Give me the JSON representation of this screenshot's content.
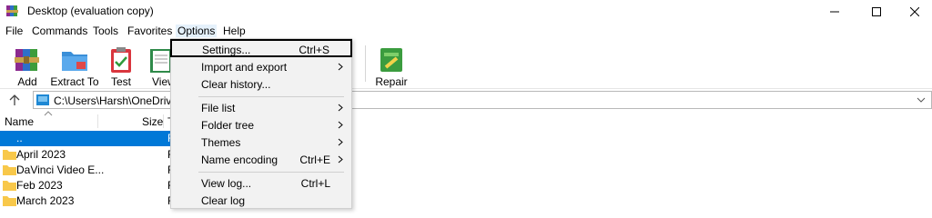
{
  "window": {
    "title": "Desktop (evaluation copy)",
    "icon": "winrar-books-icon",
    "controls": [
      "minimize-icon",
      "maximize-icon",
      "close-icon"
    ]
  },
  "menubar": {
    "items": [
      "File",
      "Commands",
      "Tools",
      "Favorites",
      "Options",
      "Help"
    ],
    "active": "Options"
  },
  "toolbar": {
    "buttons": [
      {
        "label": "Add",
        "icon": "add-archive-icon"
      },
      {
        "label": "Extract To",
        "icon": "extract-folder-icon"
      },
      {
        "label": "Test",
        "icon": "test-clipboard-icon"
      },
      {
        "label": "View",
        "icon": "view-book-icon"
      },
      {
        "label": "Repair",
        "icon": "repair-kit-icon"
      }
    ]
  },
  "addressbar": {
    "path": "C:\\Users\\Harsh\\OneDrive\\D",
    "up_icon": "up-arrow-icon",
    "chevron_icon": "chevron-down-icon"
  },
  "filelist": {
    "headers": {
      "name": "Name",
      "size": "Size",
      "type": "T"
    },
    "rows": [
      {
        "name": "..",
        "type": "F",
        "selected": true
      },
      {
        "name": "April 2023",
        "type": "F",
        "selected": false
      },
      {
        "name": "DaVinci Video E...",
        "type": "F",
        "selected": false
      },
      {
        "name": "Feb 2023",
        "type": "F",
        "selected": false
      },
      {
        "name": "March 2023",
        "type": "F",
        "selected": false
      }
    ]
  },
  "options_menu": {
    "items": [
      {
        "label": "Settings...",
        "shortcut": "Ctrl+S",
        "submenu": false,
        "highlight": true
      },
      {
        "label": "Import and export",
        "shortcut": "",
        "submenu": true
      },
      {
        "label": "Clear history...",
        "shortcut": "",
        "submenu": false
      },
      {
        "label": "File list",
        "shortcut": "",
        "submenu": true
      },
      {
        "label": "Folder tree",
        "shortcut": "",
        "submenu": true
      },
      {
        "label": "Themes",
        "shortcut": "",
        "submenu": true
      },
      {
        "label": "Name encoding",
        "shortcut": "Ctrl+E",
        "submenu": true
      },
      {
        "label": "View log...",
        "shortcut": "Ctrl+L",
        "submenu": false
      },
      {
        "label": "Clear log",
        "shortcut": "",
        "submenu": false
      }
    ]
  },
  "colors": {
    "selection": "#0078d7",
    "menu_bg": "#f2f2f2",
    "highlight_border": "#000000",
    "folder": "#f8c84a"
  }
}
